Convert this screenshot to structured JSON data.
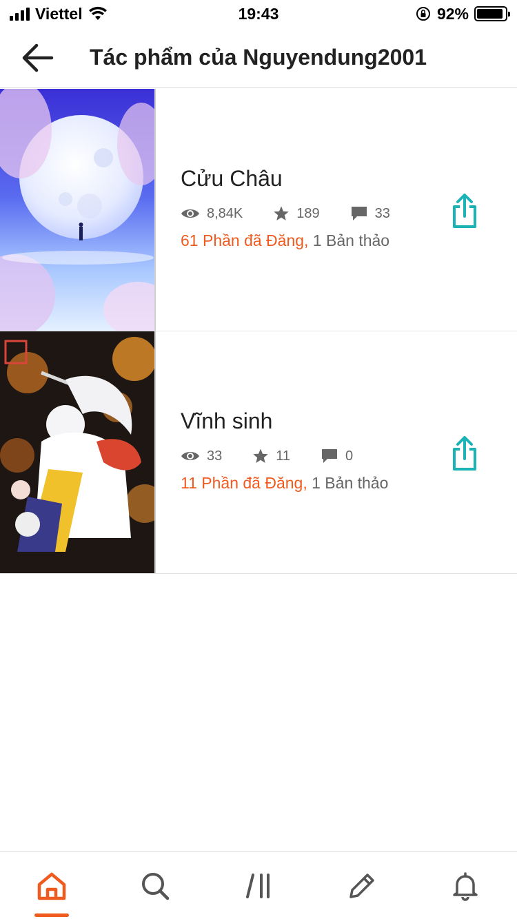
{
  "status_bar": {
    "carrier": "Viettel",
    "time": "19:43",
    "battery": "92%",
    "battery_level": 0.92
  },
  "header": {
    "title": "Tác phẩm của Nguyendung2001"
  },
  "stories": [
    {
      "title": "Cửu Châu",
      "views": "8,84K",
      "votes": "189",
      "comments": "33",
      "published": "61 Phần đã Đăng,",
      "drafts": "1 Bản thảo"
    },
    {
      "title": "Vĩnh sinh",
      "views": "33",
      "votes": "11",
      "comments": "0",
      "published": "11 Phần đã Đăng,",
      "drafts": "1 Bản thảo"
    }
  ],
  "colors": {
    "accent": "#ef5a1f",
    "share": "#1bb3b5",
    "icon_gray": "#666666"
  },
  "bottom_nav": {
    "items": [
      "home-icon",
      "search-icon",
      "library-icon",
      "write-icon",
      "notifications-icon"
    ],
    "active": "home-icon"
  }
}
